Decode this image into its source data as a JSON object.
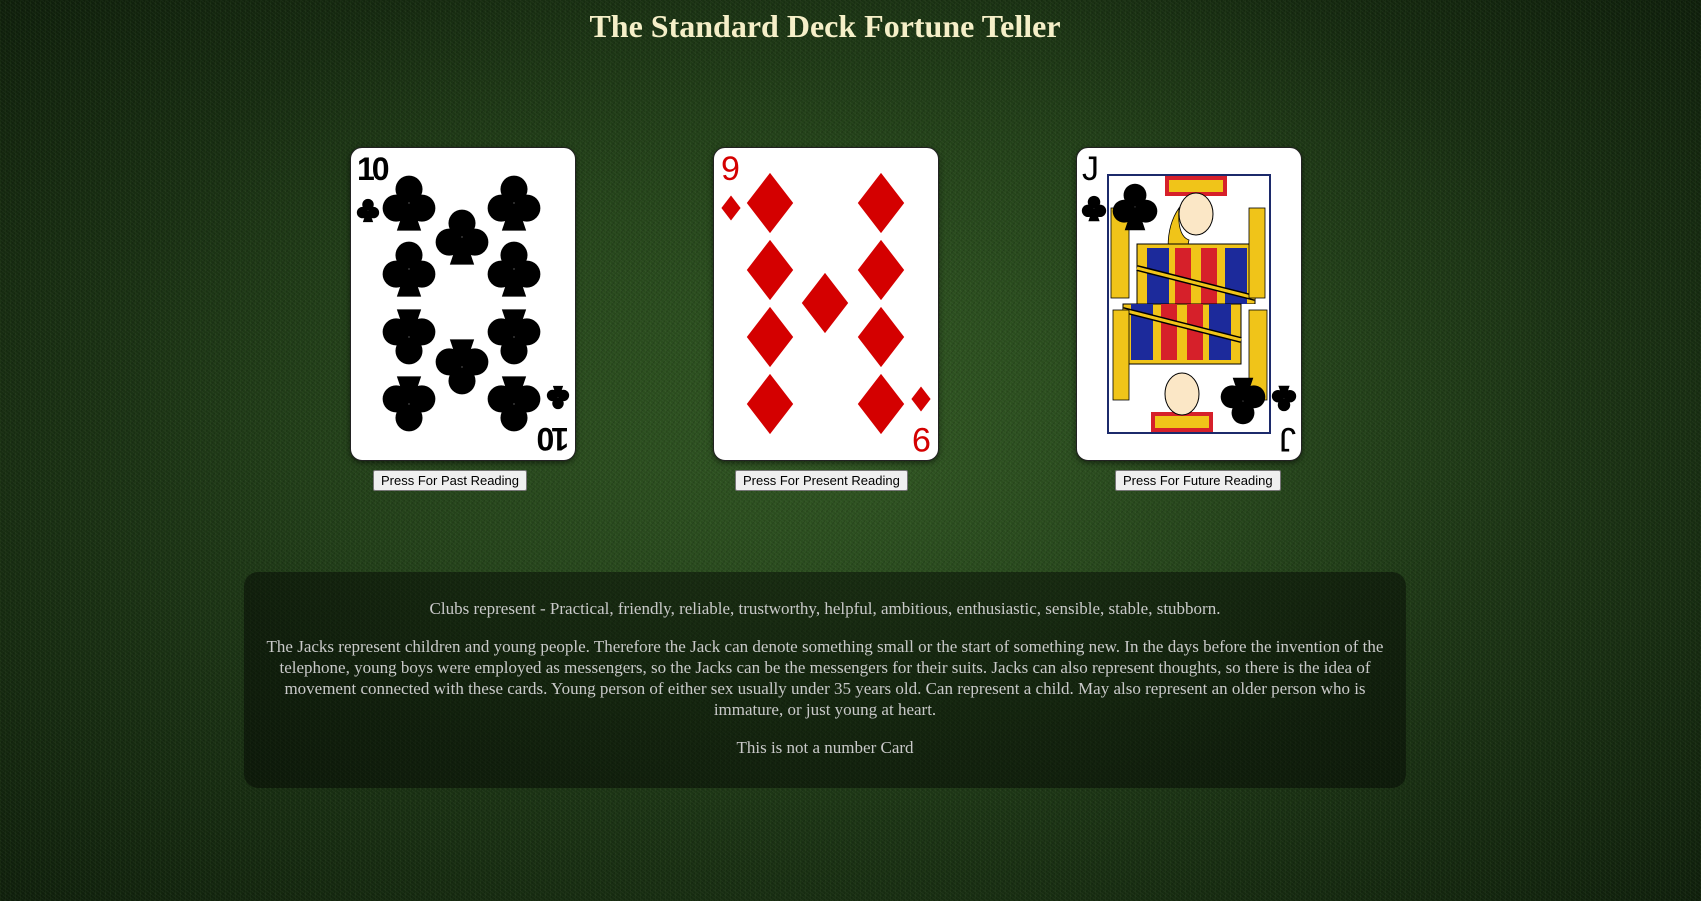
{
  "page": {
    "title": "The Standard Deck Fortune Teller"
  },
  "cards": [
    {
      "id": "past",
      "rank": "10",
      "suit": "clubs",
      "color": "#000000",
      "button_label": "Press For Past Reading"
    },
    {
      "id": "present",
      "rank": "9",
      "suit": "diamonds",
      "color": "#d40000",
      "button_label": "Press For Present Reading"
    },
    {
      "id": "future",
      "rank": "J",
      "suit": "clubs",
      "color": "#000000",
      "button_label": "Press For Future Reading"
    }
  ],
  "reading": {
    "suit_text": "Clubs represent - Practical, friendly, reliable, trustworthy, helpful, ambitious, enthusiastic, sensible, stable, stubborn.",
    "rank_text": "The Jacks represent children and young people. Therefore the Jack can denote something small or the start of something new. In the days before the invention of the telephone, young boys were employed as messengers, so the Jacks can be the messengers for their suits. Jacks can also represent thoughts, so there is the idea of movement connected with these cards. Young person of either sex usually under 35 years old. Can represent a child. May also represent an older person who is immature, or just young at heart.",
    "number_text": "This is not a number Card"
  },
  "colors": {
    "title": "#f5efc8",
    "reading_text": "#c9c9c9",
    "felt": "#1f3a17"
  }
}
